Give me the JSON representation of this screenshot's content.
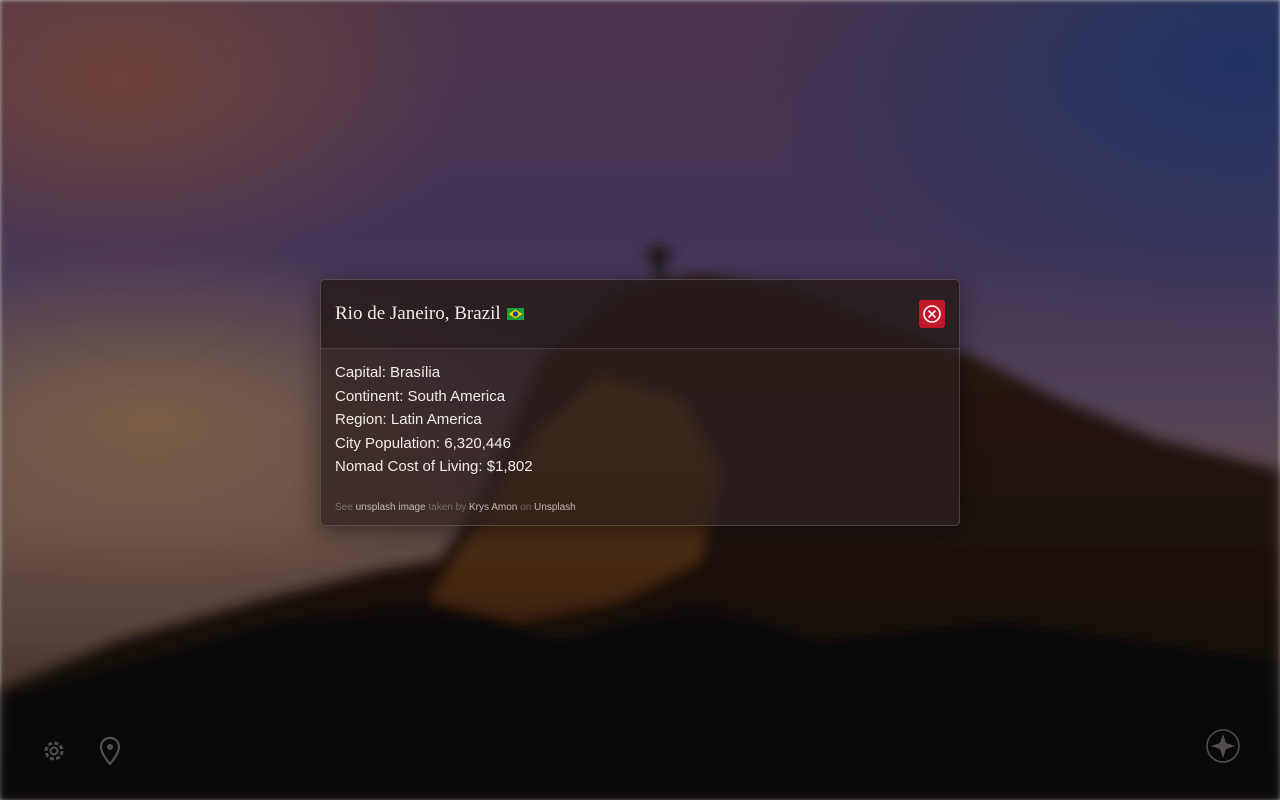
{
  "modal": {
    "title": "Rio de Janeiro, Brazil",
    "flag_icon": "brazil-flag-icon",
    "close_icon": "close-circle-icon",
    "close_color": "#c0182a",
    "details": [
      "Capital: Brasília",
      "Continent: South America",
      "Region: Latin America",
      "City Population: 6,320,446",
      "Nomad Cost of Living: $1,802"
    ],
    "credit": {
      "see": "See",
      "image_link": "unsplash image",
      "taken_by": "taken by",
      "author": "Krys Amon",
      "on": "on",
      "source": "Unsplash"
    }
  },
  "corner_icons": {
    "settings": "gear-icon",
    "location": "map-pin-icon",
    "compass": "compass-icon"
  }
}
